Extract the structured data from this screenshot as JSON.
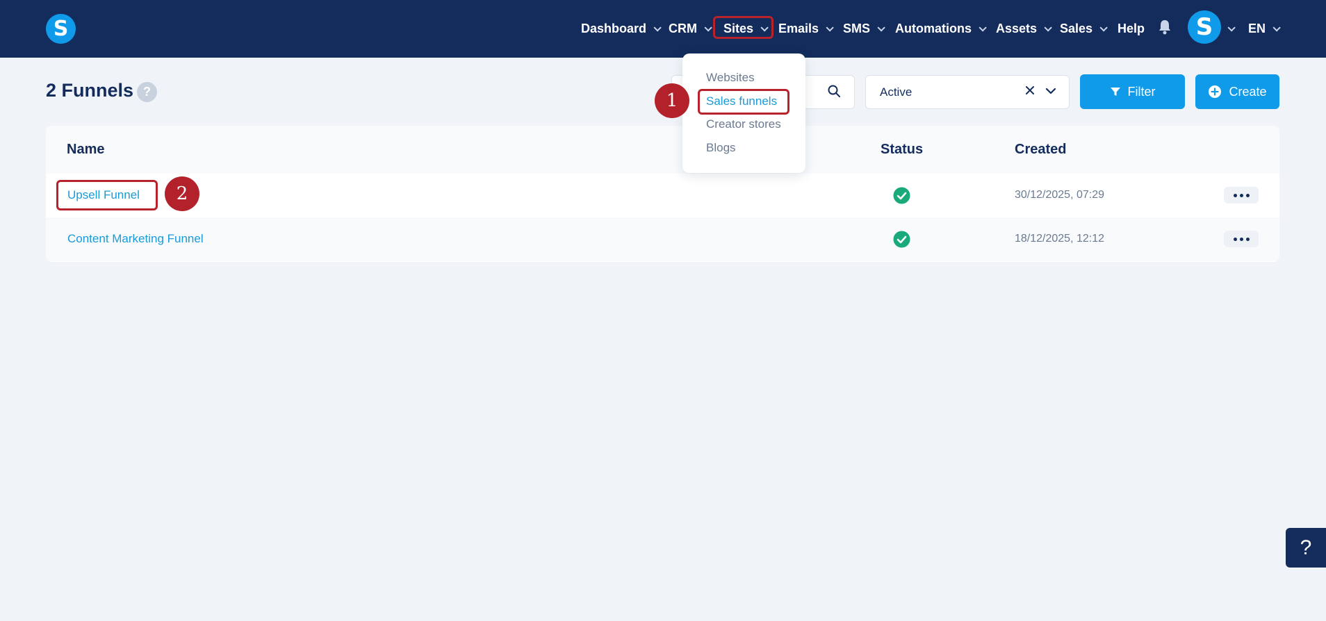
{
  "brand": {
    "logo_letter": "S",
    "accent": "#0f9aea",
    "nav_bg": "#142c5c"
  },
  "nav": {
    "items": [
      {
        "label": "Dashboard",
        "has_chevron": true
      },
      {
        "label": "CRM",
        "has_chevron": true
      },
      {
        "label": "Sites",
        "has_chevron": true,
        "highlighted": true
      },
      {
        "label": "Emails",
        "has_chevron": true
      },
      {
        "label": "SMS",
        "has_chevron": true
      },
      {
        "label": "Automations",
        "has_chevron": true
      },
      {
        "label": "Assets",
        "has_chevron": true
      },
      {
        "label": "Sales",
        "has_chevron": true
      },
      {
        "label": "Help",
        "has_chevron": false
      }
    ],
    "notifications_icon": "bell-icon",
    "avatar_letter": "S",
    "language": "EN"
  },
  "sites_menu": {
    "items": [
      {
        "label": "Websites"
      },
      {
        "label": "Sales funnels",
        "active": true
      },
      {
        "label": "Creator stores"
      },
      {
        "label": "Blogs"
      }
    ]
  },
  "annotations": {
    "step1": "1",
    "step2": "2",
    "highlight_color": "#b8222a"
  },
  "page": {
    "title": "2 Funnels",
    "help_glyph": "?",
    "search": {
      "value": "",
      "placeholder": ""
    },
    "status_filter": {
      "value": "Active"
    },
    "filter_label": "Filter",
    "create_label": "Create"
  },
  "table": {
    "columns": {
      "name": "Name",
      "status": "Status",
      "created": "Created"
    },
    "rows": [
      {
        "name": "Upsell Funnel",
        "status": "active",
        "created": "30/12/2025, 07:29"
      },
      {
        "name": "Content Marketing Funnel",
        "status": "active",
        "created": "18/12/2025, 12:12"
      }
    ],
    "status_color": "#1aa97a"
  },
  "help_widget": {
    "glyph": "?"
  }
}
